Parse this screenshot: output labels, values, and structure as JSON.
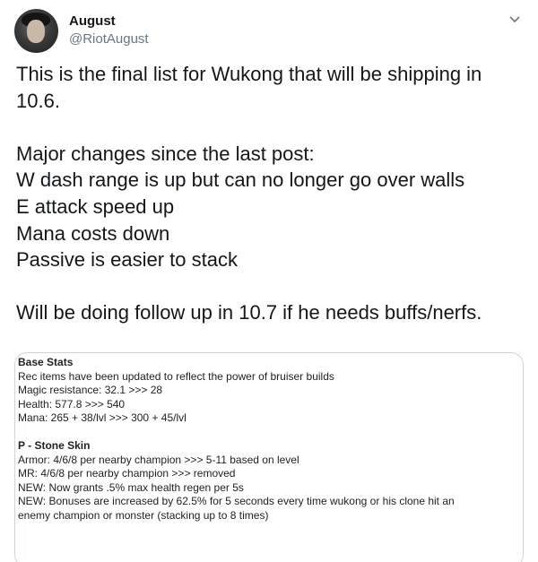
{
  "user": {
    "display_name": "August",
    "handle": "@RiotAugust"
  },
  "tweet": {
    "lines": [
      "This is the final list for Wukong that will be shipping in",
      "10.6.",
      "",
      "Major changes since the last post:",
      "W dash range is up but can no longer go over walls",
      "E attack speed up",
      "Mana costs down",
      "Passive is easier to stack",
      "",
      "Will be doing follow up in 10.7 if he needs buffs/nerfs."
    ]
  },
  "media": {
    "sections": [
      {
        "heading": "Base Stats",
        "lines": [
          "Rec items have been updated to reflect the power of bruiser builds",
          "Magic resistance: 32.1 >>> 28",
          "Health: 577.8 >>> 540",
          "Mana: 265 + 38/lvl >>> 300 + 45/lvl"
        ]
      },
      {
        "heading": "P - Stone Skin",
        "lines": [
          "Armor: 4/6/8 per nearby champion >>> 5-11 based on level",
          "MR: 4/6/8 per nearby champion >>> removed",
          "NEW: Now grants .5% max health regen per 5s",
          "NEW: Bonuses are increased by 62.5% for 5 seconds every time wukong or his clone hit an",
          "enemy champion or monster (stacking up to 8 times)"
        ]
      }
    ]
  },
  "icons": {
    "caret": "chevron-down-icon"
  }
}
